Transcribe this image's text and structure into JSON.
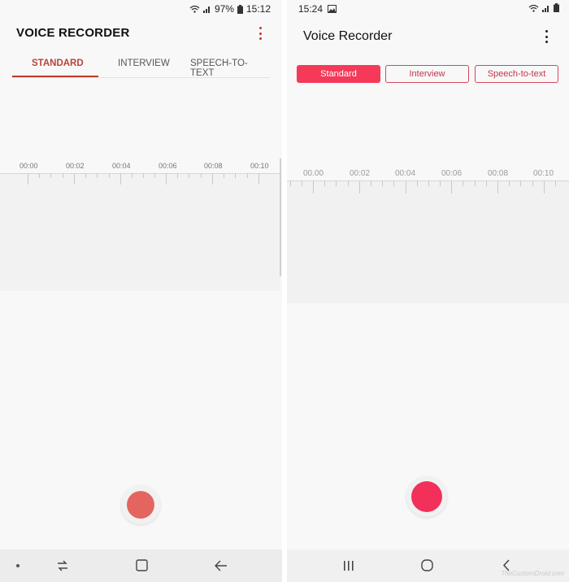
{
  "left": {
    "status": {
      "battery": "97%",
      "time": "15:12"
    },
    "title": "VOICE RECORDER",
    "tabs": [
      "STANDARD",
      "INTERVIEW",
      "SPEECH-TO-TEXT"
    ],
    "timeline": [
      "00:00",
      "00:02",
      "00:04",
      "00:06",
      "00:08",
      "00:10"
    ]
  },
  "right": {
    "status": {
      "time": "15:24"
    },
    "title": "Voice Recorder",
    "modes": [
      "Standard",
      "Interview",
      "Speech-to-text"
    ],
    "timeline": [
      "00.00",
      "00:02",
      "00:04",
      "00:06",
      "00:08",
      "00:10"
    ],
    "watermark": "TheCustomDroid.com"
  },
  "colors": {
    "left_accent": "#c0392b",
    "left_record": "#e4655f",
    "right_accent": "#f43a58",
    "right_record": "#f2305a"
  },
  "icons": [
    "wifi-icon",
    "signal-icon",
    "battery-icon",
    "image-notification-icon",
    "more-options-icon",
    "record-icon",
    "recents-icon",
    "home-icon",
    "back-icon"
  ]
}
